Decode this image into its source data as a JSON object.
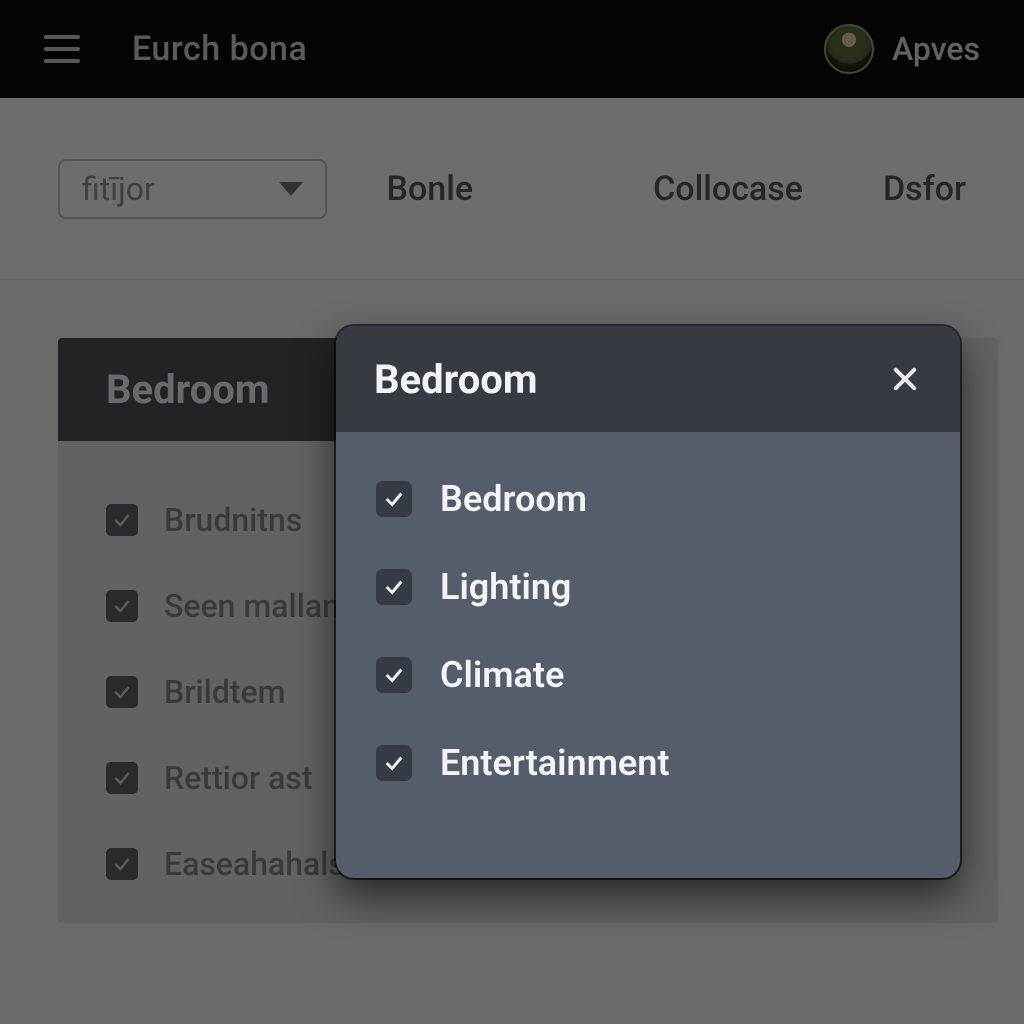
{
  "header": {
    "app_title": "Eurch bona",
    "username": "Apves"
  },
  "toolbar": {
    "filter_value": "fitījor",
    "tabs": [
      "Bonle",
      "Collocase",
      "Dsfor"
    ]
  },
  "card": {
    "title": "Bedroom",
    "items": [
      {
        "label": "Brudnitns",
        "checked": true
      },
      {
        "label": "Seen mallan",
        "checked": true
      },
      {
        "label": "Brildtem",
        "checked": true
      },
      {
        "label": "Rettior ast",
        "checked": true
      },
      {
        "label": "Easeahahals",
        "checked": true
      }
    ]
  },
  "modal": {
    "title": "Bedroom",
    "items": [
      {
        "label": "Bedroom",
        "checked": true
      },
      {
        "label": "Lighting",
        "checked": true
      },
      {
        "label": "Climate",
        "checked": true
      },
      {
        "label": "Entertainment",
        "checked": true
      }
    ]
  }
}
